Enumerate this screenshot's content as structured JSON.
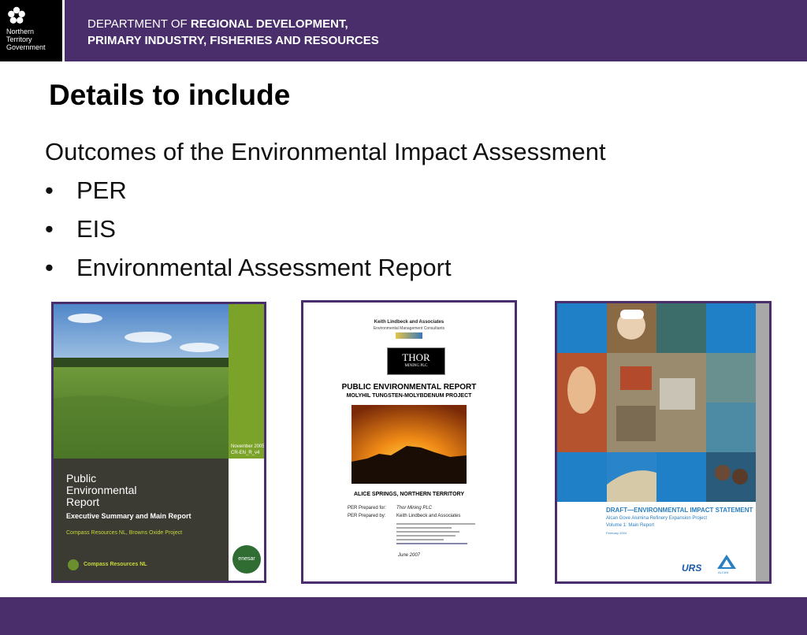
{
  "header": {
    "logo_lines": [
      "Northern",
      "Territory",
      "Government"
    ],
    "dept_line1_prefix": "DEPARTMENT OF ",
    "dept_line1_bold": "REGIONAL DEVELOPMENT,",
    "dept_line2": "PRIMARY INDUSTRY, FISHERIES AND RESOURCES"
  },
  "slide": {
    "title": "Details to include",
    "intro": "Outcomes of the Environmental Impact Assessment",
    "bullets": [
      "PER",
      "EIS",
      "Environmental Assessment Report"
    ]
  },
  "covers": {
    "per_compass": {
      "date": "November 2005",
      "code": "CR-EN_R_v4",
      "title_l1": "Public",
      "title_l2": "Environmental",
      "title_l3": "Report",
      "subtitle": "Executive Summary and Main Report",
      "project": "Compass Resources NL, Browns Oxide Project",
      "company": "Compass Resources NL",
      "badge": "enesar"
    },
    "per_thor": {
      "consultant": "Keith Lindbeck and Associates",
      "consultant_sub": "Environmental Management Consultants",
      "logo_line1": "THOR",
      "logo_line2": "MINING PLC",
      "title": "PUBLIC ENVIRONMENTAL REPORT",
      "subtitle": "MOLYHIL TUNGSTEN-MOLYBDENUM PROJECT",
      "location": "ALICE SPRINGS, NORTHERN TERRITORY",
      "prepared_for_label": "PER Prepared for:",
      "prepared_for": "Thor Mining PLC",
      "prepared_by_label": "PER Prepared by:",
      "prepared_by": "Keith Lindbeck and Associates",
      "date": "June 2007"
    },
    "eis_alcan": {
      "title": "DRAFT—ENVIRONMENTAL IMPACT STATEMENT",
      "subtitle": "Alcan Gove Alumina Refinery Expansion Project",
      "volume": "Volume 1: Main Report",
      "date": "February 2004",
      "logo1": "URS",
      "logo2": "ALCAN"
    }
  }
}
